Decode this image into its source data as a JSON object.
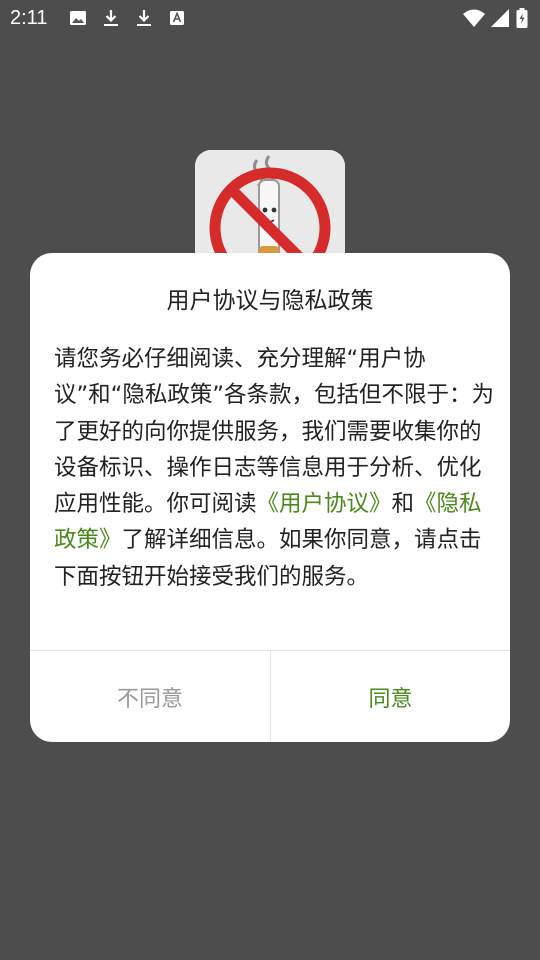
{
  "status_bar": {
    "time": "2:11",
    "left_icons": [
      "image-icon",
      "download-icon",
      "download-icon",
      "text-icon"
    ],
    "right_icons": [
      "wifi-icon",
      "signal-icon",
      "battery-icon"
    ]
  },
  "app_logo": {
    "description_icon": "no-smoking-icon"
  },
  "dialog": {
    "title": "用户协议与隐私政策",
    "body_part1": "请您务必仔细阅读、充分理解“用户协议”和“隐私政策”各条款，包括但不限于：为了更好的向你提供服务，我们需要收集你的设备标识、操作日志等信息用于分析、优化应用性能。你可阅读",
    "link_user_agreement": "《用户协议》",
    "body_and": "和",
    "link_privacy_policy": "《隐私政策》",
    "body_part2": "了解详细信息。如果你同意，请点击下面按钮开始接受我们的服务。",
    "disagree_label": "不同意",
    "agree_label": "同意"
  },
  "colors": {
    "background": "#4d4d4d",
    "link": "#4a8a1c",
    "disagree_text": "#999999"
  }
}
